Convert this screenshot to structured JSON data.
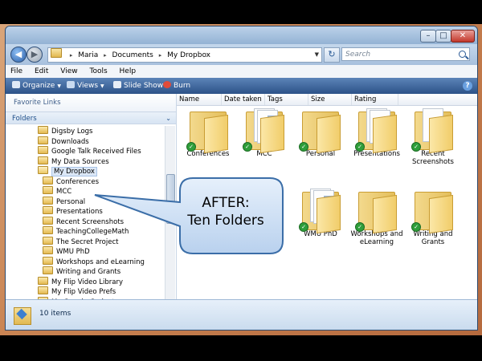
{
  "window": {
    "controls": {
      "minimize": "–",
      "maximize": "□",
      "close": "✕"
    }
  },
  "address": {
    "crumbs": [
      "Maria",
      "Documents",
      "My Dropbox"
    ],
    "search_placeholder": "Search",
    "refresh_glyph": "↻"
  },
  "menu": [
    "File",
    "Edit",
    "View",
    "Tools",
    "Help"
  ],
  "toolbar": {
    "organize": "Organize",
    "views": "Views",
    "slideshow": "Slide Show",
    "burn": "Burn",
    "help": "?"
  },
  "nav": {
    "favorite_links": "Favorite Links",
    "folders": "Folders",
    "tree": [
      {
        "label": "Digsby Logs",
        "level": 1
      },
      {
        "label": "Downloads",
        "level": 1
      },
      {
        "label": "Google Talk Received Files",
        "level": 1
      },
      {
        "label": "My Data Sources",
        "level": 1
      },
      {
        "label": "My Dropbox",
        "level": 1
      },
      {
        "label": "Conferences",
        "level": 2
      },
      {
        "label": "MCC",
        "level": 2
      },
      {
        "label": "Personal",
        "level": 2
      },
      {
        "label": "Presentations",
        "level": 2
      },
      {
        "label": "Recent Screenshots",
        "level": 2
      },
      {
        "label": "TeachingCollegeMath",
        "level": 2
      },
      {
        "label": "The Secret Project",
        "level": 2
      },
      {
        "label": "WMU PhD",
        "level": 2
      },
      {
        "label": "Workshops and eLearning",
        "level": 2
      },
      {
        "label": "Writing and Grants",
        "level": 2
      },
      {
        "label": "My Flip Video Library",
        "level": 1
      },
      {
        "label": "My Flip Video Prefs",
        "level": 1
      },
      {
        "label": "My Google Gadgets",
        "level": 1
      }
    ]
  },
  "columns": [
    "Name",
    "Date taken",
    "Tags",
    "Size",
    "Rating"
  ],
  "items": [
    "Conferences",
    "MCC",
    "Personal",
    "Presentations",
    "Recent Screenshots",
    "WMU PhD",
    "Workshops and eLearning",
    "Writing and Grants"
  ],
  "status": {
    "count": "10 items"
  },
  "callout": {
    "line1": "AFTER:",
    "line2": "Ten Folders"
  }
}
